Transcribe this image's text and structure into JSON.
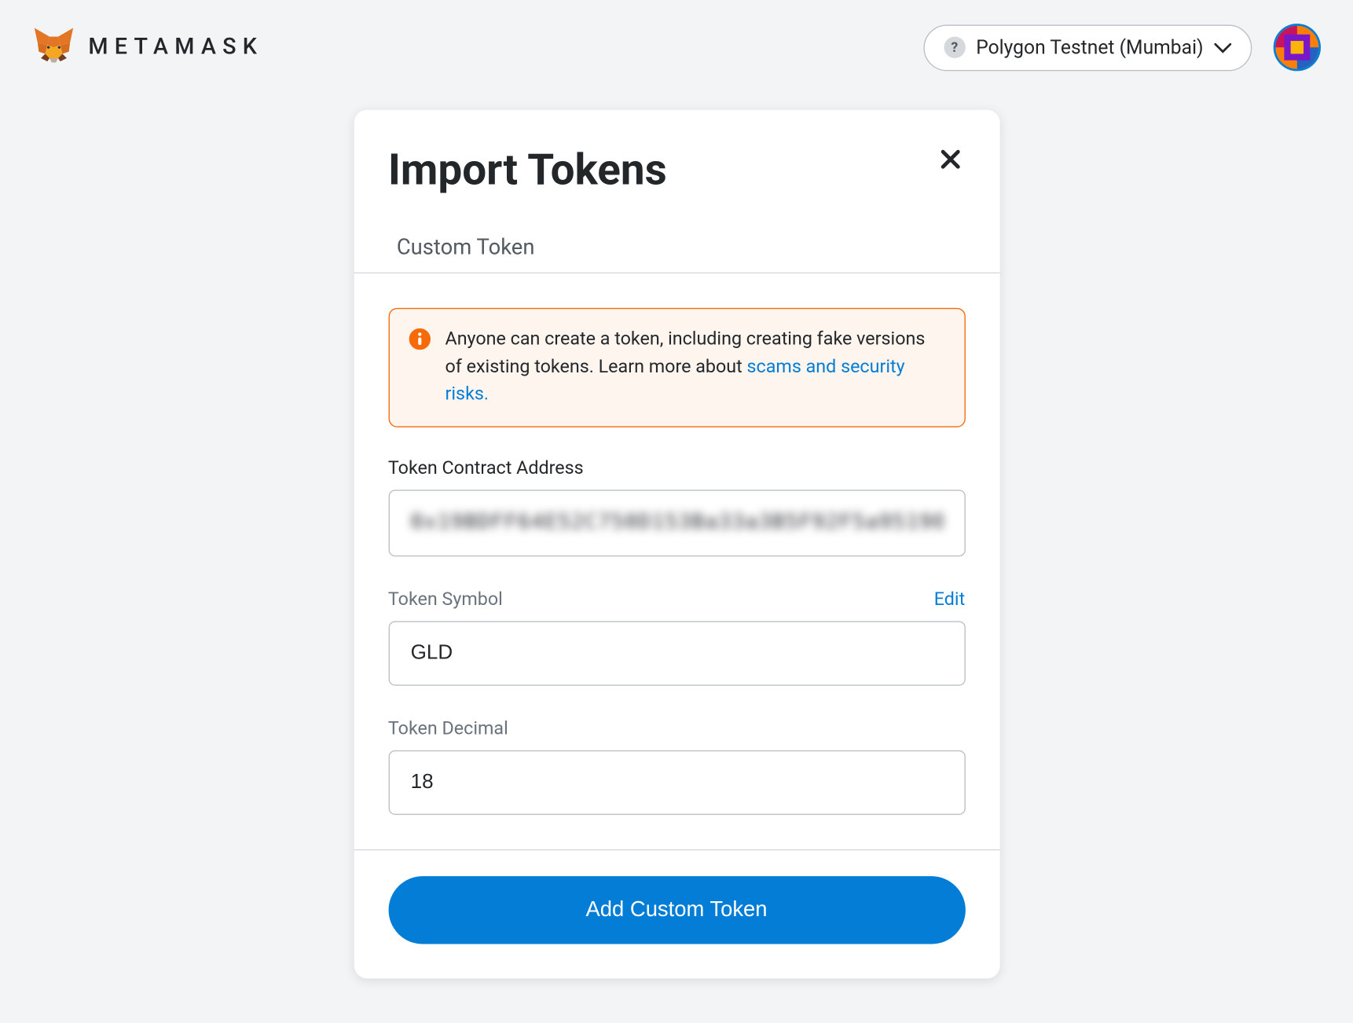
{
  "header": {
    "brand_text": "METAMASK",
    "network_name": "Polygon Testnet (Mumbai)",
    "network_icon_char": "?"
  },
  "modal": {
    "title": "Import Tokens",
    "tab": "Custom Token",
    "warning": {
      "text_before": "Anyone can create a token, including creating fake versions of existing tokens. Learn more about ",
      "link_text": "scams and security risks."
    },
    "fields": {
      "address": {
        "label": "Token Contract Address",
        "value_masked": "0x19BDFF64E52C750D153Ba33a3B5F92F5a95190"
      },
      "symbol": {
        "label": "Token Symbol",
        "edit_label": "Edit",
        "value": "GLD"
      },
      "decimal": {
        "label": "Token Decimal",
        "value": "18"
      }
    },
    "submit_label": "Add Custom Token"
  }
}
